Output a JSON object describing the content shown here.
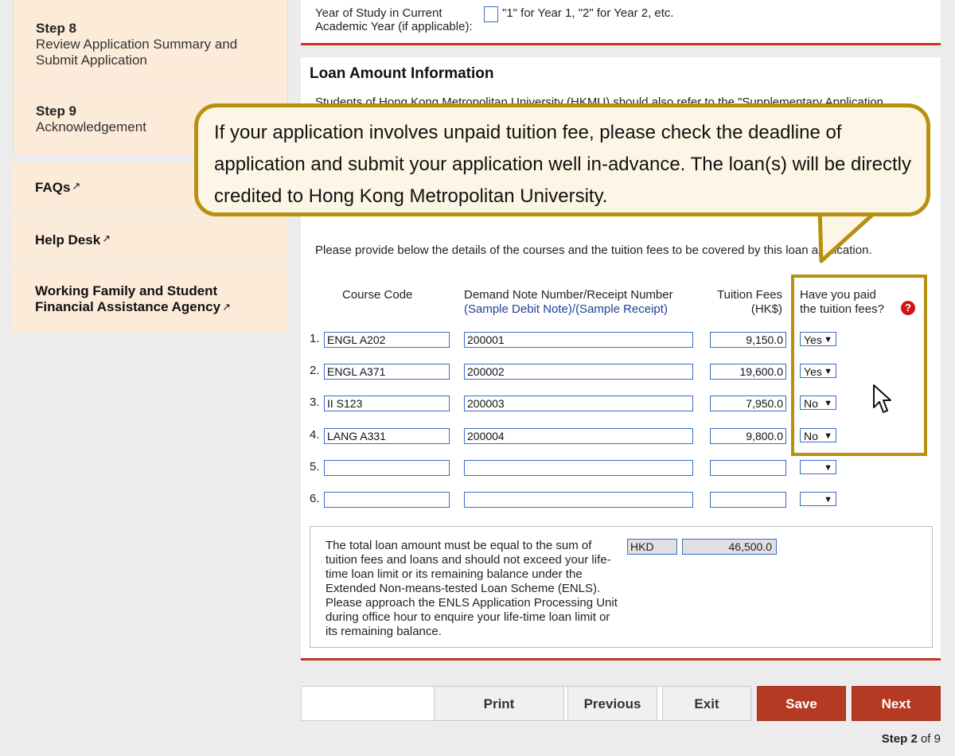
{
  "sidebar": {
    "step8": {
      "label": "Step 8",
      "desc_line1": "Review Application Summary and",
      "desc_line2": "Submit Application"
    },
    "step9": {
      "label": "Step 9",
      "desc": "Acknowledgement"
    },
    "faqs": "FAQs",
    "help_desk": "Help Desk",
    "agency_line1": "Working Family and Student",
    "agency_line2": "Financial Assistance Agency"
  },
  "year_of_study": {
    "label_line1": "Year of Study in Current",
    "label_line2": "Academic Year (if applicable):",
    "value": "",
    "hint": "\"1\" for Year 1, \"2\" for Year 2, etc."
  },
  "loan": {
    "title": "Loan Amount Information",
    "note": "Students of Hong Kong Metropolitan University (HKMU) should also refer to the \"Supplementary Application",
    "provide_text": "Please provide below the details of the courses and the tuition fees to be covered by this loan application.",
    "headers": {
      "course_code": "Course Code",
      "demand_note": "Demand Note Number/Receipt Number",
      "sample_debit": "(Sample Debit Note)",
      "sample_receipt": "(Sample Receipt)",
      "tuition_line1": "Tuition Fees",
      "tuition_line2": "(HK$)",
      "paid_line1": "Have you paid",
      "paid_line2": "the tuition fees?"
    },
    "rows": [
      {
        "num": "1.",
        "course": "ENGL A202",
        "note": "200001",
        "fee": "9,150.0",
        "paid": "Yes"
      },
      {
        "num": "2.",
        "course": "ENGL A371",
        "note": "200002",
        "fee": "19,600.0",
        "paid": "Yes"
      },
      {
        "num": "3.",
        "course": "II S123",
        "note": "200003",
        "fee": "7,950.0",
        "paid": "No"
      },
      {
        "num": "4.",
        "course": "LANG A331",
        "note": "200004",
        "fee": "9,800.0",
        "paid": "No"
      },
      {
        "num": "5.",
        "course": "",
        "note": "",
        "fee": "",
        "paid": ""
      },
      {
        "num": "6.",
        "course": "",
        "note": "",
        "fee": "",
        "paid": ""
      }
    ],
    "total_text": "The total loan amount must be equal to the sum of tuition fees and loans and should not exceed your life-time loan limit or its remaining balance under the Extended Non-means-tested Loan Scheme (ENLS). Please approach the ENLS Application Processing Unit during office hour to enquire your life-time loan limit or its remaining balance.",
    "currency": "HKD",
    "total_amount": "46,500.0"
  },
  "buttons": {
    "print": "Print",
    "previous": "Previous",
    "exit": "Exit",
    "save": "Save",
    "next": "Next"
  },
  "step_indicator": {
    "step_word": "Step",
    "current": "2",
    "of_total": "of 9"
  },
  "callout": "If your application involves unpaid tuition fee, please check the deadline of application and submit your application well in-advance. The loan(s) will be directly credited to Hong Kong Metropolitan University.",
  "colors": {
    "accent_red": "#b53a23",
    "callout_border": "#b8900f",
    "sidebar_bg": "#fdebd9",
    "input_border": "#3a6cc7"
  }
}
